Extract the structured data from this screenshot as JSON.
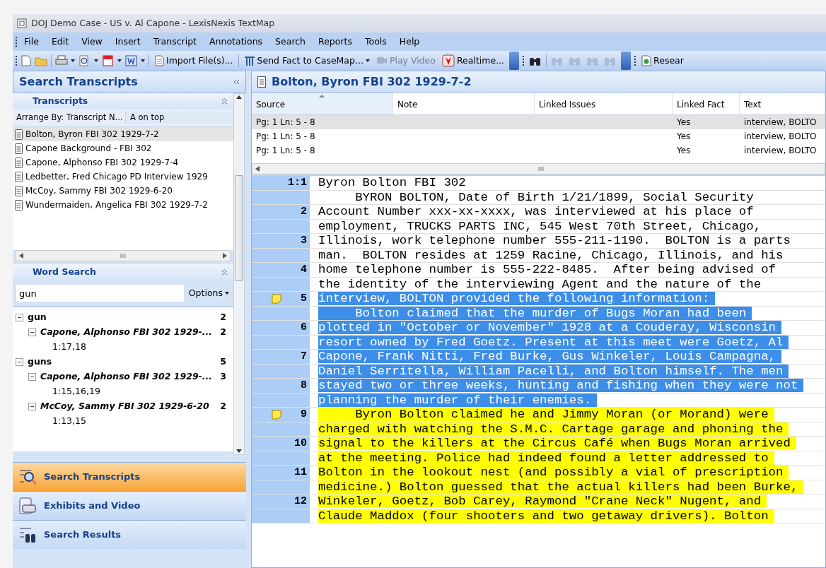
{
  "window": {
    "title": "DOJ Demo Case - US v. Al Capone - LexisNexis TextMap"
  },
  "menu": [
    {
      "label": "File"
    },
    {
      "label": "Edit"
    },
    {
      "label": "View"
    },
    {
      "label": "Insert"
    },
    {
      "label": "Transcript"
    },
    {
      "label": "Annotations"
    },
    {
      "label": "Search"
    },
    {
      "label": "Reports"
    },
    {
      "label": "Tools"
    },
    {
      "label": "Help"
    }
  ],
  "toolbar": {
    "import_label": "Import File(s)...",
    "send_fact_label": "Send Fact to CaseMap...",
    "play_video": {
      "label": "Play Video",
      "disabled": true
    },
    "realtime_label": "Realtime...",
    "find_buttons": [
      {
        "disabled": false
      },
      {
        "disabled": true
      },
      {
        "disabled": true
      },
      {
        "disabled": true
      },
      {
        "disabled": true
      }
    ],
    "research_label": "Resear"
  },
  "sidebar": {
    "title": "Search Transcripts",
    "transcripts": {
      "title": "Transcripts",
      "arrange_by": "Arrange By: Transcript N...",
      "order": "A on top",
      "items": [
        {
          "label": "Bolton, Byron FBI 302 1929-7-2",
          "selected": true
        },
        {
          "label": "Capone Background - FBI 302",
          "selected": false
        },
        {
          "label": "Capone, Alphonso FBI 302 1929-7-4",
          "selected": false
        },
        {
          "label": "Ledbetter, Fred Chicago PD Interview 1929",
          "selected": false
        },
        {
          "label": "McCoy, Sammy FBI 302 1929-6-20",
          "selected": false
        },
        {
          "label": "Wundermaiden, Angelica FBI 302 1929-7-2",
          "selected": false
        }
      ]
    },
    "word_search": {
      "title": "Word Search",
      "query": "gun",
      "options_label": "Options",
      "results": [
        {
          "label": "gun",
          "count": "2",
          "expanded": true,
          "children": [
            {
              "label": "Capone, Alphonso FBI 302 1929-...",
              "count": "2",
              "expanded": true,
              "children": [
                {
                  "label": "1:17,18"
                }
              ]
            }
          ]
        },
        {
          "label": "guns",
          "count": "5",
          "expanded": true,
          "children": [
            {
              "label": "Capone, Alphonso FBI 302 1929-...",
              "count": "3",
              "expanded": true,
              "children": [
                {
                  "label": "1:15,16,19"
                }
              ]
            },
            {
              "label": "McCoy, Sammy FBI 302 1929-6-20",
              "count": "2",
              "expanded": true,
              "children": [
                {
                  "label": "1:13,15"
                }
              ]
            }
          ]
        }
      ]
    },
    "nav": [
      {
        "label": "Search Transcripts",
        "selected": true
      },
      {
        "label": "Exhibits and Video",
        "selected": false
      },
      {
        "label": "Search Results",
        "selected": false
      }
    ]
  },
  "document": {
    "title": "Bolton, Byron FBI 302 1929-7-2",
    "table": {
      "columns": [
        {
          "label": "Source",
          "sorted": true
        },
        {
          "label": "Note",
          "sorted": false
        },
        {
          "label": "Linked Issues",
          "sorted": false
        },
        {
          "label": "Linked Fact",
          "sorted": false
        },
        {
          "label": "Text",
          "sorted": false
        }
      ],
      "rows": [
        {
          "cells": [
            "Pg: 1 Ln: 5 - 8",
            "",
            "",
            "Yes",
            "interview, BOLTO"
          ],
          "selected": true
        },
        {
          "cells": [
            "Pg: 1 Ln: 5 - 8",
            "",
            "",
            "Yes",
            "interview, BOLTO"
          ],
          "selected": false
        },
        {
          "cells": [
            "Pg: 1 Ln: 5 - 8",
            "",
            "",
            "Yes",
            "interview, BOLTO"
          ],
          "selected": false
        }
      ]
    },
    "lines": [
      {
        "number": "1:1",
        "text": "Byron Bolton FBI 302",
        "note": false
      },
      {
        "text": "     BYRON BOLTON, Date of Birth 1/21/1899, Social Security",
        "note": false
      },
      {
        "number": "2",
        "text": "Account Number xxx-xx-xxxx, was interviewed at his place of",
        "note": false
      },
      {
        "text": "employment, TRUCKS PARTS INC, 545 West 70th Street, Chicago,",
        "note": false
      },
      {
        "number": "3",
        "text": "Illinois, work telephone number 555-211-1190.  BOLTON is a parts",
        "note": false
      },
      {
        "text": "man.  BOLTON resides at 1259 Racine, Chicago, Illinois, and his",
        "note": false
      },
      {
        "number": "4",
        "text": "home telephone number is 555-222-8485.  After being advised of",
        "note": false
      },
      {
        "text": "the identity of the interviewing Agent and the nature of the",
        "note": false
      },
      {
        "number": "5",
        "text": "interview, BOLTON provided the following information:",
        "color": "#3d8ee8",
        "note": true
      },
      {
        "text": "     Bolton claimed that the murder of Bugs Moran had been",
        "color": "#3d8ee8",
        "note": false
      },
      {
        "number": "6",
        "text": "plotted in \"October or November\" 1928 at a Couderay, Wisconsin",
        "color": "#3d8ee8",
        "note": false
      },
      {
        "text": "resort owned by Fred Goetz. Present at this meet were Goetz, Al",
        "color": "#3d8ee8",
        "note": false
      },
      {
        "number": "7",
        "text": "Capone, Frank Nitti, Fred Burke, Gus Winkeler, Louis Campagna,",
        "color": "#3d8ee8",
        "note": false
      },
      {
        "text": "Daniel Serritella, William Pacelli, and Bolton himself. The men",
        "color": "#3d8ee8",
        "note": false
      },
      {
        "number": "8",
        "text": "stayed two or three weeks, hunting and fishing when they were not",
        "color": "#3d8ee8",
        "note": false
      },
      {
        "text": "planning the murder of their enemies.",
        "color": "#3d8ee8",
        "note": false
      },
      {
        "number": "9",
        "text": "     Byron Bolton claimed he and Jimmy Moran (or Morand) were",
        "color": "#ffff00",
        "note": true
      },
      {
        "text": "charged with watching the S.M.C. Cartage garage and phoning the",
        "color": "#ffff00",
        "note": false
      },
      {
        "number": "10",
        "text": "signal to the killers at the Circus Café when Bugs Moran arrived",
        "color": "#ffff00",
        "note": false
      },
      {
        "text": "at the meeting. Police had indeed found a letter addressed to",
        "color": "#ffff00",
        "note": false
      },
      {
        "number": "11",
        "text": "Bolton in the lookout nest (and possibly a vial of prescription",
        "color": "#ffff00",
        "note": false
      },
      {
        "text": "medicine.) Bolton guessed that the actual killers had been Burke,",
        "color": "#ffff00",
        "note": false
      },
      {
        "number": "12",
        "text": "Winkeler, Goetz, Bob Carey, Raymond \"Crane Neck\" Nugent, and",
        "color": "#ffff00",
        "note": false
      },
      {
        "text": "Claude Maddox (four shooters and two getaway drivers). Bolton",
        "color": "#ffff00",
        "note": false
      }
    ]
  }
}
